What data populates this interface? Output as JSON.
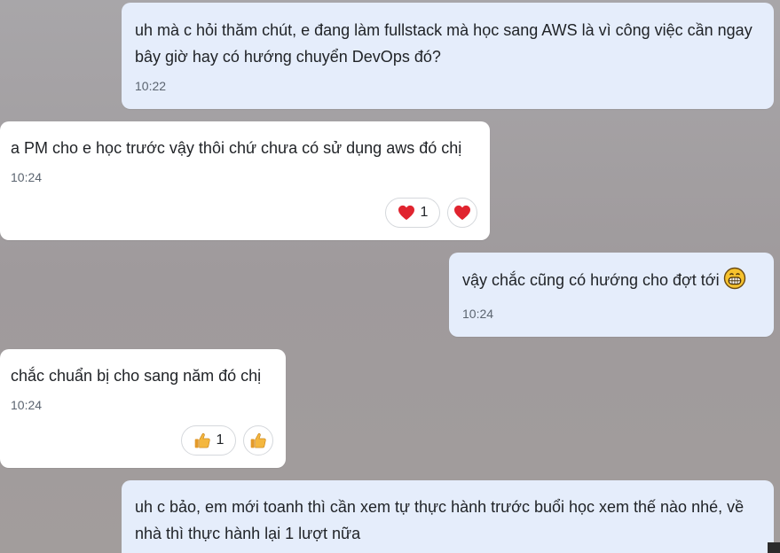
{
  "messages": [
    {
      "direction": "outgoing",
      "text": "uh mà c hỏi thăm chút, e đang làm fullstack mà học sang AWS là vì công việc cần ngay bây giờ hay có hướng chuyển DevOps đó?",
      "time": "10:22"
    },
    {
      "direction": "incoming",
      "text": "a PM cho e học trước vậy thôi chứ chưa có sử dụng aws đó chị",
      "time": "10:24",
      "reactions": [
        {
          "icon": "heart-icon",
          "count": "1"
        },
        {
          "icon": "heart-icon"
        }
      ]
    },
    {
      "direction": "outgoing",
      "text": "vậy chắc cũng có hướng cho đợt tới",
      "emoji": "grinning-face-icon",
      "time": "10:24"
    },
    {
      "direction": "incoming",
      "text": "chắc chuẩn bị cho sang năm đó chị",
      "time": "10:24",
      "reactions": [
        {
          "icon": "thumbs-up-icon",
          "count": "1"
        },
        {
          "icon": "thumbs-up-icon"
        }
      ]
    },
    {
      "direction": "outgoing",
      "text": "uh c bảo, em mới toanh thì cần xem tự thực hành trước buổi học xem thế nào nhé, về nhà thì thực hành lại 1 lượt nữa"
    }
  ],
  "colors": {
    "outgoing_bubble": "#e5edfb",
    "incoming_bubble": "#ffffff",
    "heart": "#e0242f",
    "thumbs_up": "#f4b73f"
  }
}
